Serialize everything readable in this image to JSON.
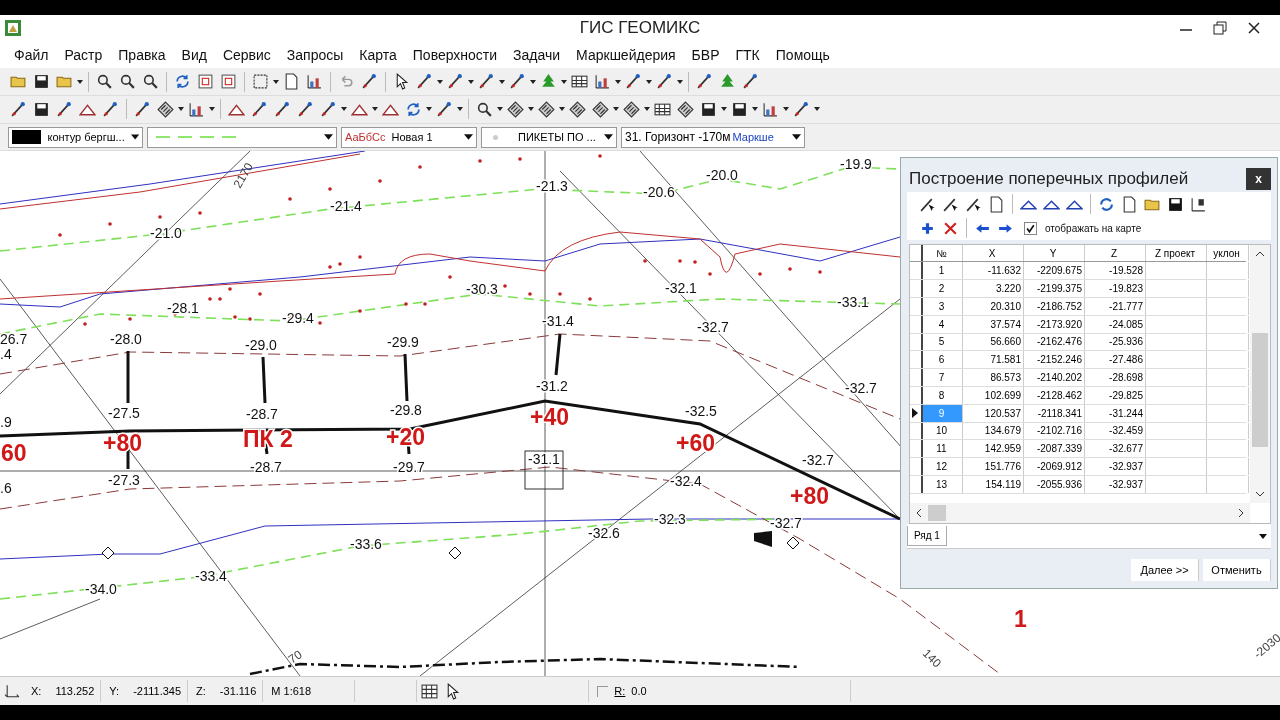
{
  "window": {
    "title": "ГИС ГЕОМИКС"
  },
  "menu": [
    "Файл",
    "Растр",
    "Правка",
    "Вид",
    "Сервис",
    "Запросы",
    "Карта",
    "Поверхности",
    "Задачи",
    "Маркшейдерия",
    "БВР",
    "ГТК",
    "Помощь"
  ],
  "style_bar": {
    "layer": "контур бергш...",
    "font_sample": "АаБбСс",
    "font_style": "Новая 1",
    "symbol_layer": "ПИКЕТЫ ПО ...",
    "horizon": "31. Горизонт -170м",
    "horizon_suffix": "Маркше"
  },
  "map": {
    "elevations": [
      "-19.9",
      "-20.0",
      "-21.3",
      "-20.6",
      "-21.4",
      "-21.0",
      "-30.3",
      "-32.1",
      "-33.1",
      "-28.1",
      "-29.4",
      "-31.4",
      "-32.7",
      "26.7",
      "-28.0",
      "-29.0",
      "-29.9",
      ".4",
      "-32.7",
      "-31.2",
      "-27.5",
      "-28.7",
      "-29.8",
      "-32.5",
      ".9",
      "-32.7",
      "-31.1",
      "-28.7",
      "-29.7",
      ".6",
      "-27.3",
      "-32.4",
      "-32.3",
      "-32.7",
      "-32.6",
      "-33.6",
      "-33.4",
      "-34.0"
    ],
    "pickets": [
      "60",
      "+80",
      "ПК 2",
      "+20",
      "+40",
      "+60",
      "+80",
      "1"
    ],
    "contour_labels": [
      "2170",
      "70",
      "140",
      "-2030"
    ]
  },
  "dialog": {
    "title": "Построение поперечных профилей",
    "close": "x",
    "show_on_map": {
      "label": "отображать на карте",
      "checked": true
    },
    "table": {
      "columns": [
        "№",
        "X",
        "Y",
        "Z",
        "Z проект",
        "уклон"
      ],
      "rows": [
        {
          "cells": [
            "1",
            "-11.632",
            "-2209.675",
            "-19.528"
          ],
          "selected": false
        },
        {
          "cells": [
            "2",
            "3.220",
            "-2199.375",
            "-19.823"
          ],
          "selected": false
        },
        {
          "cells": [
            "3",
            "20.310",
            "-2186.752",
            "-21.777"
          ],
          "selected": false
        },
        {
          "cells": [
            "4",
            "37.574",
            "-2173.920",
            "-24.085"
          ],
          "selected": false
        },
        {
          "cells": [
            "5",
            "56.660",
            "-2162.476",
            "-25.936"
          ],
          "selected": false
        },
        {
          "cells": [
            "6",
            "71.581",
            "-2152.246",
            "-27.486"
          ],
          "selected": false
        },
        {
          "cells": [
            "7",
            "86.573",
            "-2140.202",
            "-28.698"
          ],
          "selected": false
        },
        {
          "cells": [
            "8",
            "102.699",
            "-2128.462",
            "-29.825"
          ],
          "selected": false
        },
        {
          "cells": [
            "9",
            "120.537",
            "-2118.341",
            "-31.244"
          ],
          "selected": true
        },
        {
          "cells": [
            "10",
            "134.679",
            "-2102.716",
            "-32.459"
          ],
          "selected": false
        },
        {
          "cells": [
            "11",
            "142.959",
            "-2087.339",
            "-32.677"
          ],
          "selected": false
        },
        {
          "cells": [
            "12",
            "151.776",
            "-2069.912",
            "-32.937"
          ],
          "selected": false
        },
        {
          "cells": [
            "13",
            "154.119",
            "-2055.936",
            "-32.937"
          ],
          "selected": false
        }
      ]
    },
    "tabs": [
      {
        "label": "Ряд 1",
        "selected": true
      }
    ],
    "buttons": [
      "Далее >>",
      "Отменить"
    ]
  },
  "status_bar": {
    "fields": [
      {
        "label": "X:",
        "value": "113.252"
      },
      {
        "label": "Y:",
        "value": "-2111.345"
      },
      {
        "label": "Z:",
        "value": "-31.116"
      }
    ],
    "scale": "M 1:618",
    "radius": {
      "label": "R:",
      "value": "0.0"
    }
  }
}
